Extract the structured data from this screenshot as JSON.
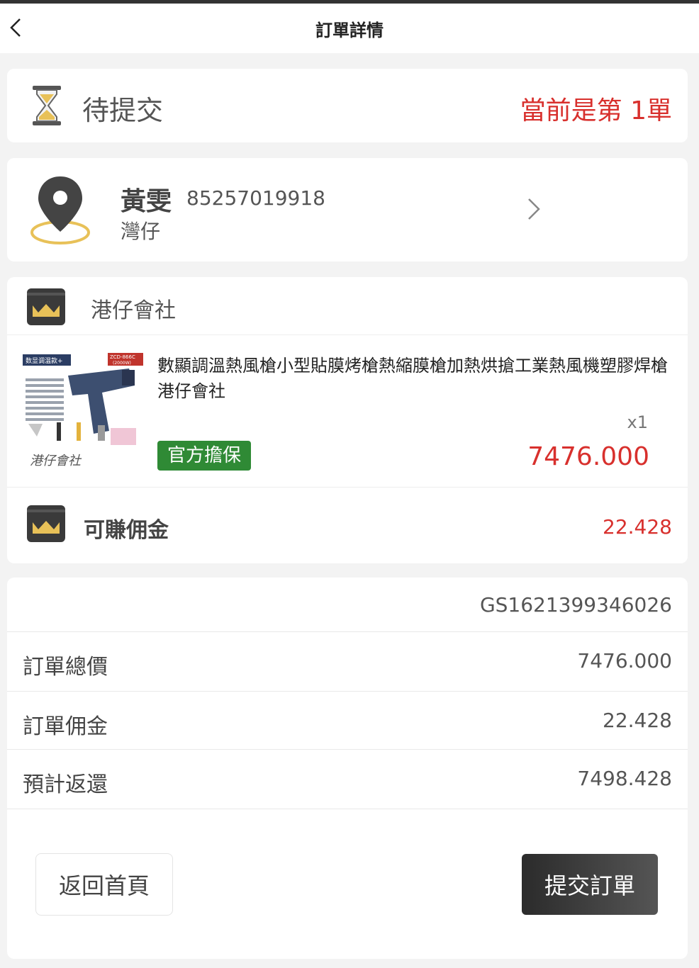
{
  "nav": {
    "title": "訂單詳情"
  },
  "status": {
    "text": "待提交",
    "sequence": "當前是第 1單"
  },
  "address": {
    "name": "黃雯",
    "phone": "85257019918",
    "area": "灣仔"
  },
  "shop": {
    "name": "港仔會社"
  },
  "product": {
    "title": "數顯調溫熱風槍小型貼膜烤槍熱縮膜槍加熱烘搶工業熱風機塑膠焊槍 港仔會社",
    "quantity": "x1",
    "badge": "官方擔保",
    "price": "7476.000",
    "image_text": {
      "tag": "数显调温款+",
      "model": "ZCD-866C",
      "power": "(2000W)",
      "watermark": "港仔會社"
    }
  },
  "commission": {
    "label": "可賺佣金",
    "value": "22.428"
  },
  "summary": {
    "order_id": "GS1621399346026",
    "rows": [
      {
        "label": "訂單總價",
        "value": "7476.000"
      },
      {
        "label": "訂單佣金",
        "value": "22.428"
      },
      {
        "label": "預計返還",
        "value": "7498.428"
      }
    ]
  },
  "buttons": {
    "home": "返回首頁",
    "submit": "提交訂單"
  },
  "colors": {
    "accent_red": "#d8302d",
    "badge_green": "#2f8a35",
    "gold": "#e8c158",
    "dark": "#333333"
  }
}
